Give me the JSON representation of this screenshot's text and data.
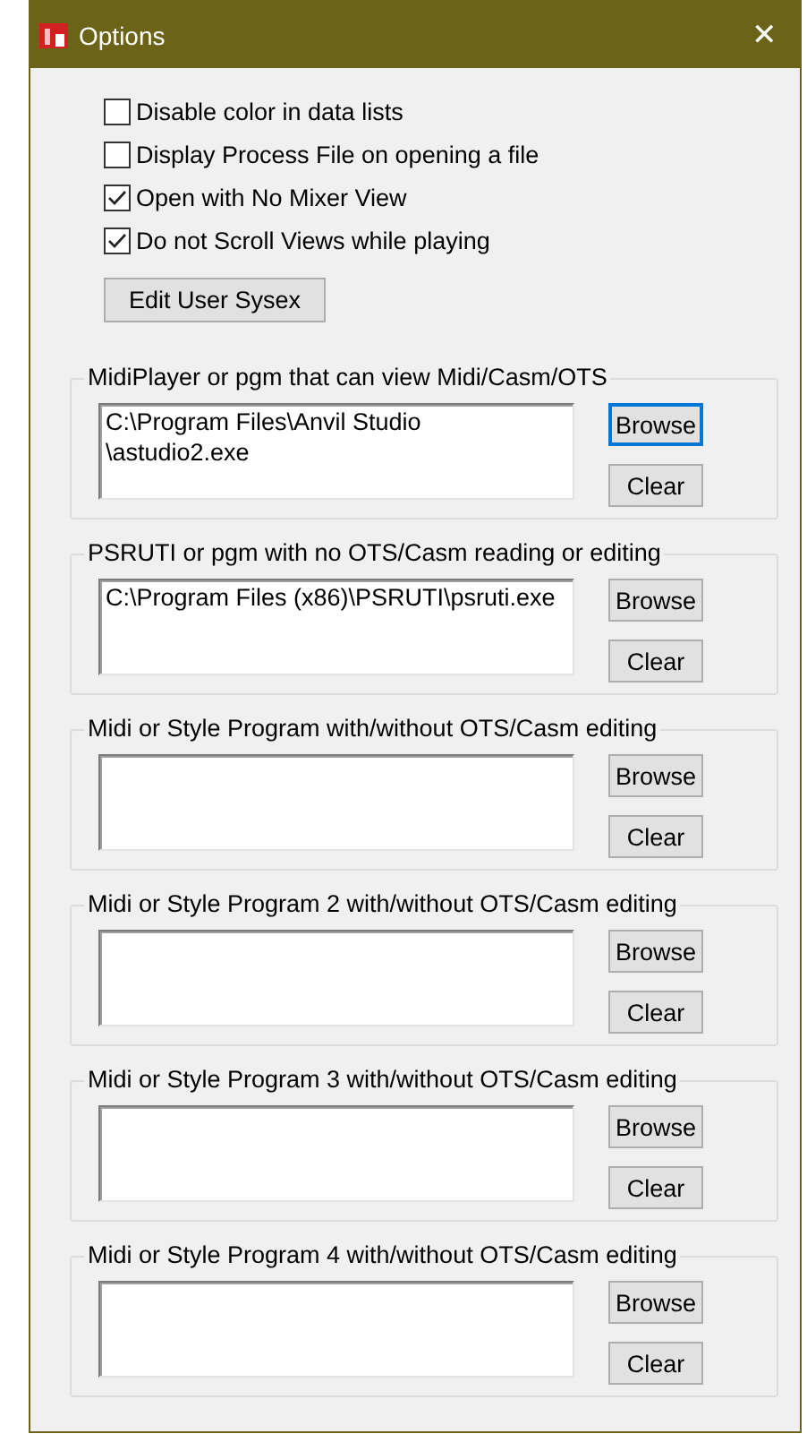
{
  "window": {
    "title": "Options",
    "close": "✕"
  },
  "checkboxes": [
    {
      "label": "Disable color in data lists",
      "checked": false
    },
    {
      "label": "Display Process File on opening a file",
      "checked": false
    },
    {
      "label": "Open with No Mixer View",
      "checked": true
    },
    {
      "label": "Do not Scroll Views while playing",
      "checked": true
    }
  ],
  "edit_button": "Edit User Sysex",
  "groups": [
    {
      "label": "MidiPlayer or pgm that can view Midi/Casm/OTS",
      "value_lines": [
        "C:\\Program Files\\Anvil Studio",
        "\\astudio2.exe"
      ],
      "browse": "Browse",
      "clear": "Clear",
      "browse_focused": true
    },
    {
      "label": "PSRUTI or pgm with no OTS/Casm reading or editing",
      "value_lines": [
        "C:\\Program Files (x86)\\PSRUTI\\psruti.exe"
      ],
      "browse": "Browse",
      "clear": "Clear",
      "browse_focused": false
    },
    {
      "label": "Midi or Style Program with/without OTS/Casm editing",
      "browse": "Browse",
      "clear": "Clear",
      "browse_focused": false
    },
    {
      "label": "Midi or Style Program 2 with/without OTS/Casm editing",
      "browse": "Browse",
      "clear": "Clear",
      "browse_focused": false
    },
    {
      "label": "Midi or Style Program 3 with/without OTS/Casm editing",
      "browse": "Browse",
      "clear": "Clear",
      "browse_focused": false
    },
    {
      "label": "Midi or Style Program 4 with/without OTS/Casm editing",
      "browse": "Browse",
      "clear": "Clear",
      "browse_focused": false
    }
  ]
}
